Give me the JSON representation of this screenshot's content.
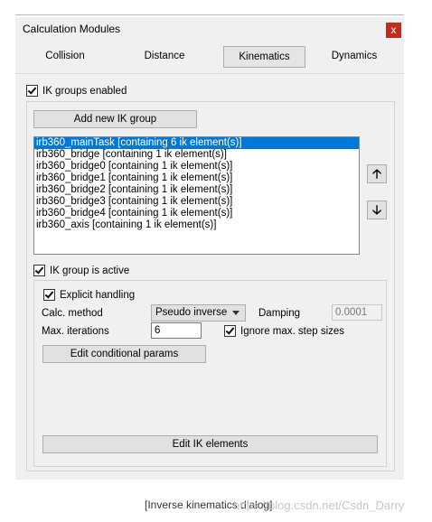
{
  "window": {
    "title": "Calculation Modules",
    "close_glyph": "x"
  },
  "tabs": [
    "Collision",
    "Distance",
    "Kinematics",
    "Dynamics"
  ],
  "active_tab": "Kinematics",
  "ik_groups_enabled": {
    "label": "IK groups enabled",
    "checked": true
  },
  "add_group_button": "Add new IK group",
  "groups_list": [
    "irb360_mainTask [containing 6 ik element(s)]",
    "irb360_bridge [containing 1 ik element(s)]",
    "irb360_bridge0 [containing 1 ik element(s)]",
    "irb360_bridge1 [containing 1 ik element(s)]",
    "irb360_bridge2 [containing 1 ik element(s)]",
    "irb360_bridge3 [containing 1 ik element(s)]",
    "irb360_bridge4 [containing 1 ik element(s)]",
    "irb360_axis [containing 1 ik element(s)]"
  ],
  "selected_index": 0,
  "move_up_icon": "arrow-up-icon",
  "move_down_icon": "arrow-down-icon",
  "ik_group_active": {
    "label": "IK group is active",
    "checked": true
  },
  "explicit_handling": {
    "label": "Explicit handling",
    "checked": true
  },
  "calc_method": {
    "label": "Calc. method",
    "value": "Pseudo inverse"
  },
  "damping": {
    "label": "Damping",
    "value": "0.0001"
  },
  "max_iterations": {
    "label": "Max. iterations",
    "value": "6"
  },
  "ignore_max_step": {
    "label": "Ignore max. step sizes",
    "checked": true
  },
  "edit_conditional_button": "Edit conditional params",
  "edit_ik_button": "Edit IK elements",
  "caption": "[Inverse kinematics dialog]",
  "watermark": "https://blog.csdn.net/Csdn_Darry"
}
